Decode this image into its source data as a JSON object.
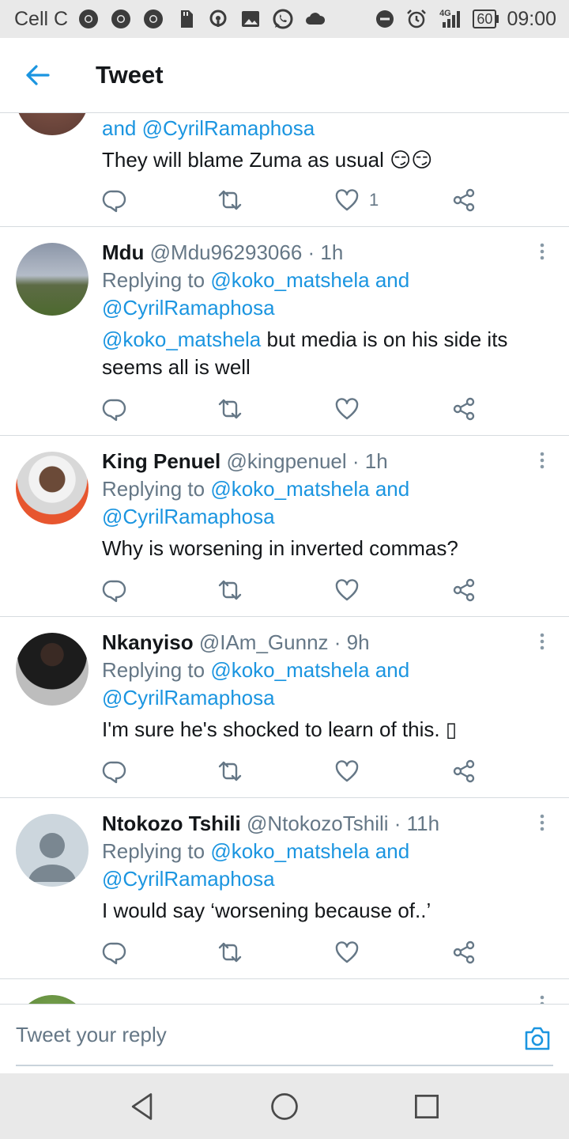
{
  "status_bar": {
    "carrier": "Cell C",
    "network": "4G",
    "battery": "60",
    "time": "09:00"
  },
  "header": {
    "title": "Tweet",
    "back_icon": "arrow-left-icon"
  },
  "colors": {
    "accent": "#1b95e0",
    "text": "#14171a",
    "secondary_text": "#657786",
    "divider": "#d6dbdf"
  },
  "partial_tweet": {
    "reply_continuation": "and @CyrilRamaphosa",
    "text": "They will blame Zuma as usual 😏😏",
    "like_count": "1"
  },
  "tweets": [
    {
      "name": "Mdu",
      "handle": "@Mdu96293066",
      "time": "· 1h",
      "replying_prefix": "Replying to",
      "replying_mention_1": "@koko_matshela",
      "replying_and": "and",
      "replying_mention_2": "@CyrilRamaphosa",
      "text_mention": "@koko_matshela",
      "text": " but media is on his side its seems all is well"
    },
    {
      "name": "King Penuel",
      "handle": "@kingpenuel",
      "time": "· 1h",
      "replying_prefix": "Replying to",
      "replying_mention_1": "@koko_matshela",
      "replying_and": "and",
      "replying_mention_2": "@CyrilRamaphosa",
      "text": "Why is worsening in inverted commas?"
    },
    {
      "name": "Nkanyiso",
      "handle": "@IAm_Gunnz",
      "time": "· 9h",
      "replying_prefix": "Replying to",
      "replying_mention_1": "@koko_matshela",
      "replying_and": "and",
      "replying_mention_2": "@CyrilRamaphosa",
      "text": "I'm sure he's shocked to learn of this. ▯"
    },
    {
      "name": "Ntokozo Tshili",
      "handle": "@NtokozoTshili",
      "time": "· 11h",
      "replying_prefix": "Replying to",
      "replying_mention_1": "@koko_matshela",
      "replying_and": "and",
      "replying_mention_2": "@CyrilRamaphosa",
      "text": "I would say ‘worsening because of..’"
    }
  ],
  "composer": {
    "placeholder": "Tweet your reply",
    "camera_icon": "camera-icon"
  },
  "nav_bar": {
    "back_icon": "triangle-back-icon",
    "home_icon": "circle-home-icon",
    "recents_icon": "square-recents-icon"
  }
}
